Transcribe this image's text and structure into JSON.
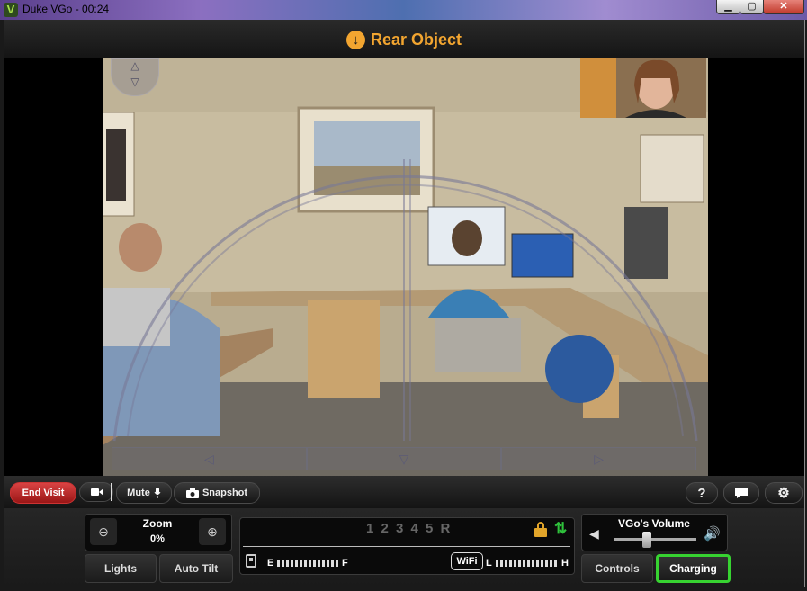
{
  "window": {
    "title": "Duke VGo - 00:24",
    "app_icon": "V",
    "minimize": "▁",
    "maximize": "▢",
    "close": "✕"
  },
  "header": {
    "icon": "down-arrow-circle-icon",
    "title": "Rear Object",
    "accent_color": "#f2a530"
  },
  "video": {
    "nav_up": "△",
    "nav_down": "▽",
    "nav_left": "◁",
    "nav_back": "▽",
    "nav_right": "▷"
  },
  "toolbar": {
    "end_visit": "End Visit",
    "mute": "Mute",
    "snapshot": "Snapshot",
    "help": "?",
    "settings_glyph": "⚙",
    "end_visit_color": "#c62828"
  },
  "zoom": {
    "label": "Zoom",
    "value": "0%",
    "out_glyph": "⊖",
    "in_glyph": "⊕"
  },
  "buttons": {
    "lights": "Lights",
    "auto_tilt": "Auto Tilt",
    "controls": "Controls",
    "charging": "Charging",
    "charging_color": "#37d331"
  },
  "status": {
    "gears": "1 2 3 4 5 R",
    "fuel_empty": "E",
    "fuel_full": "F",
    "wifi": "WiFi",
    "wifi_low": "L",
    "wifi_high": "H",
    "updown_glyph": "⇅"
  },
  "volume": {
    "label": "VGo's Volume",
    "low_glyph": "◀",
    "high_glyph": "🔊",
    "level": 0.4
  }
}
